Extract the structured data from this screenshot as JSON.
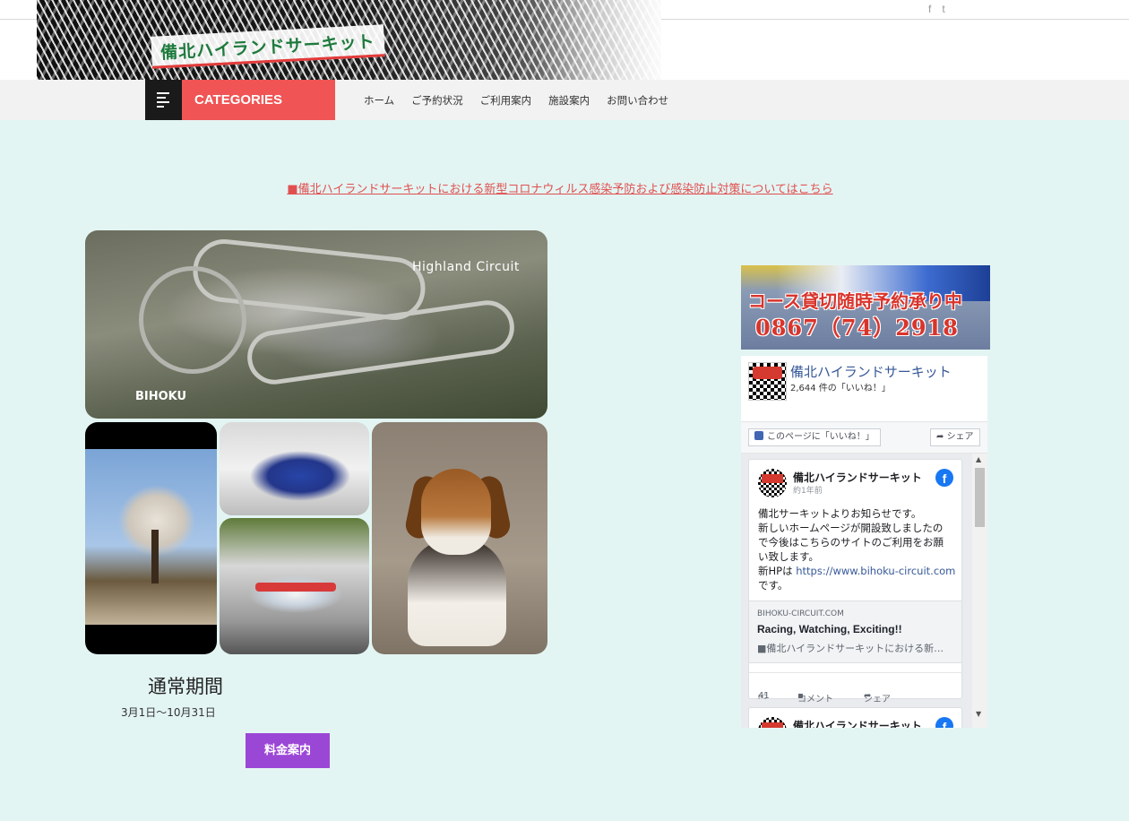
{
  "topbar": {
    "social": [
      {
        "icon": "facebook-icon",
        "glyph": "f"
      },
      {
        "icon": "twitter-icon",
        "glyph": "t"
      }
    ]
  },
  "header": {
    "logo_text": "備北ハイランドサーキット"
  },
  "nav": {
    "categories_label": "CATEGORIES",
    "items": [
      "ホーム",
      "ご予約状況",
      "ご利用案内",
      "施設案内",
      "お問い合わせ"
    ]
  },
  "notice": {
    "text": "■備北ハイランドサーキットにおける新型コロナウィルス感染予防および感染防止対策についてはこちら"
  },
  "gallery": {
    "aerial_label": "Highland Circuit",
    "aerial_sublabel": "BIHOKU"
  },
  "period": {
    "title": "通常期間",
    "range": "3月1日〜10月31日",
    "button": "料金案内"
  },
  "ad": {
    "line1": "コース貸切随時予約承り中",
    "line2": "0867（74）2918"
  },
  "facebook": {
    "page_name": "備北ハイランドサーキット",
    "likes": "2,644 件の「いいね！」",
    "like_button": "このページに「いいね！」",
    "share_button": "シェア",
    "post": {
      "author": "備北ハイランドサーキット",
      "time": "約1年前",
      "text_lines": [
        "備北サーキットよりお知らせです。",
        "新しいホームページが開設致しましたの",
        "で今後はこちらのサイトのご利用をお願",
        "い致します。"
      ],
      "url_prefix": "新HPは",
      "url": "https://www.bihoku-circuit.com",
      "suffix": "です。",
      "link_domain": "BIHOKU-CIRCUIT.COM",
      "link_title": "Racing, Watching, Exciting!!",
      "link_desc": "■備北ハイランドサーキットにおける新…",
      "like_count": "41",
      "comment_label": "コメント",
      "share_label": "シェア"
    },
    "post2_author": "備北ハイランドサーキット"
  }
}
